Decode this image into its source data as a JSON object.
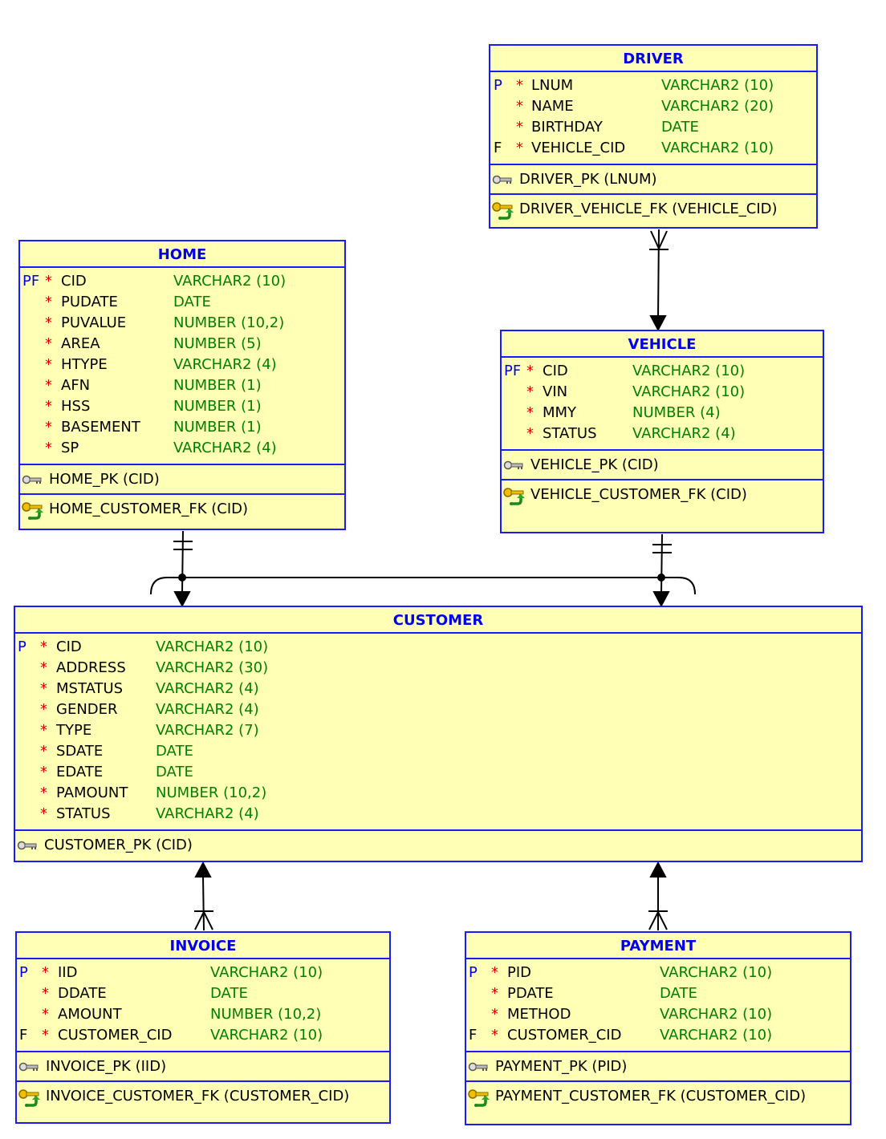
{
  "colors": {
    "header_text": "#0000ee",
    "border": "#1a1aff",
    "fill": "#ffffb5",
    "type_text": "#008000",
    "required_star": "#e00000"
  },
  "tables": [
    {
      "id": "driver",
      "name": "DRIVER",
      "columns": [
        {
          "flag": "P",
          "star": "*",
          "name": "LNUM",
          "type": "VARCHAR2 (10)"
        },
        {
          "flag": "",
          "star": "*",
          "name": "NAME",
          "type": "VARCHAR2 (20)"
        },
        {
          "flag": "",
          "star": "*",
          "name": "BIRTHDAY",
          "type": "DATE"
        },
        {
          "flag": "F",
          "star": "*",
          "name": "VEHICLE_CID",
          "type": "VARCHAR2 (10)"
        }
      ],
      "keys": [
        {
          "icon": "primary-key-icon",
          "label": "DRIVER_PK (LNUM)"
        },
        {
          "icon": "foreign-key-icon",
          "label": "DRIVER_VEHICLE_FK (VEHICLE_CID)"
        }
      ]
    },
    {
      "id": "home",
      "name": "HOME",
      "columns": [
        {
          "flag": "PF",
          "star": "*",
          "name": "CID",
          "type": "VARCHAR2 (10)"
        },
        {
          "flag": "",
          "star": "*",
          "name": "PUDATE",
          "type": "DATE"
        },
        {
          "flag": "",
          "star": "*",
          "name": "PUVALUE",
          "type": "NUMBER (10,2)"
        },
        {
          "flag": "",
          "star": "*",
          "name": "AREA",
          "type": "NUMBER (5)"
        },
        {
          "flag": "",
          "star": "*",
          "name": "HTYPE",
          "type": "VARCHAR2 (4)"
        },
        {
          "flag": "",
          "star": "*",
          "name": "AFN",
          "type": "NUMBER (1)"
        },
        {
          "flag": "",
          "star": "*",
          "name": "HSS",
          "type": "NUMBER (1)"
        },
        {
          "flag": "",
          "star": "*",
          "name": "BASEMENT",
          "type": "NUMBER (1)"
        },
        {
          "flag": "",
          "star": "*",
          "name": "SP",
          "type": "VARCHAR2 (4)"
        }
      ],
      "keys": [
        {
          "icon": "primary-key-icon",
          "label": "HOME_PK (CID)"
        },
        {
          "icon": "foreign-key-icon",
          "label": "HOME_CUSTOMER_FK (CID)"
        }
      ]
    },
    {
      "id": "vehicle",
      "name": "VEHICLE",
      "columns": [
        {
          "flag": "PF",
          "star": "*",
          "name": "CID",
          "type": "VARCHAR2 (10)"
        },
        {
          "flag": "",
          "star": "*",
          "name": "VIN",
          "type": "VARCHAR2 (10)"
        },
        {
          "flag": "",
          "star": "*",
          "name": "MMY",
          "type": "NUMBER (4)"
        },
        {
          "flag": "",
          "star": "*",
          "name": "STATUS",
          "type": "VARCHAR2 (4)"
        }
      ],
      "keys": [
        {
          "icon": "primary-key-icon",
          "label": "VEHICLE_PK (CID)"
        },
        {
          "icon": "foreign-key-icon",
          "label": "VEHICLE_CUSTOMER_FK (CID)"
        }
      ]
    },
    {
      "id": "customer",
      "name": "CUSTOMER",
      "columns": [
        {
          "flag": "P",
          "star": "*",
          "name": "CID",
          "type": "VARCHAR2 (10)"
        },
        {
          "flag": "",
          "star": "*",
          "name": "ADDRESS",
          "type": "VARCHAR2 (30)"
        },
        {
          "flag": "",
          "star": "*",
          "name": "MSTATUS",
          "type": "VARCHAR2 (4)"
        },
        {
          "flag": "",
          "star": "*",
          "name": "GENDER",
          "type": "VARCHAR2 (4)"
        },
        {
          "flag": "",
          "star": "*",
          "name": "TYPE",
          "type": "VARCHAR2 (7)"
        },
        {
          "flag": "",
          "star": "*",
          "name": "SDATE",
          "type": "DATE"
        },
        {
          "flag": "",
          "star": "*",
          "name": "EDATE",
          "type": "DATE"
        },
        {
          "flag": "",
          "star": "*",
          "name": "PAMOUNT",
          "type": "NUMBER (10,2)"
        },
        {
          "flag": "",
          "star": "*",
          "name": "STATUS",
          "type": "VARCHAR2 (4)"
        }
      ],
      "keys": [
        {
          "icon": "primary-key-icon",
          "label": "CUSTOMER_PK (CID)"
        }
      ]
    },
    {
      "id": "invoice",
      "name": "INVOICE",
      "columns": [
        {
          "flag": "P",
          "star": "*",
          "name": "IID",
          "type": "VARCHAR2 (10)"
        },
        {
          "flag": "",
          "star": "*",
          "name": "DDATE",
          "type": "DATE"
        },
        {
          "flag": "",
          "star": "*",
          "name": "AMOUNT",
          "type": "NUMBER (10,2)"
        },
        {
          "flag": "F",
          "star": "*",
          "name": "CUSTOMER_CID",
          "type": "VARCHAR2 (10)"
        }
      ],
      "keys": [
        {
          "icon": "primary-key-icon",
          "label": "INVOICE_PK (IID)"
        },
        {
          "icon": "foreign-key-icon",
          "label": "INVOICE_CUSTOMER_FK (CUSTOMER_CID)"
        }
      ]
    },
    {
      "id": "payment",
      "name": "PAYMENT",
      "columns": [
        {
          "flag": "P",
          "star": "*",
          "name": "PID",
          "type": "VARCHAR2 (10)"
        },
        {
          "flag": "",
          "star": "*",
          "name": "PDATE",
          "type": "DATE"
        },
        {
          "flag": "",
          "star": "*",
          "name": "METHOD",
          "type": "VARCHAR2 (10)"
        },
        {
          "flag": "F",
          "star": "*",
          "name": "CUSTOMER_CID",
          "type": "VARCHAR2 (10)"
        }
      ],
      "keys": [
        {
          "icon": "primary-key-icon",
          "label": "PAYMENT_PK (PID)"
        },
        {
          "icon": "foreign-key-icon",
          "label": "PAYMENT_CUSTOMER_FK (CUSTOMER_CID)"
        }
      ]
    }
  ],
  "relationships": [
    {
      "from": "driver",
      "to": "vehicle",
      "from_end": "many",
      "to_end": "one"
    },
    {
      "from": "home",
      "to": "customer",
      "from_end": "one",
      "to_end": "one",
      "arc": true
    },
    {
      "from": "vehicle",
      "to": "customer",
      "from_end": "one",
      "to_end": "one",
      "arc": true
    },
    {
      "from": "invoice",
      "to": "customer",
      "from_end": "many",
      "to_end": "one"
    },
    {
      "from": "payment",
      "to": "customer",
      "from_end": "many",
      "to_end": "one"
    }
  ]
}
